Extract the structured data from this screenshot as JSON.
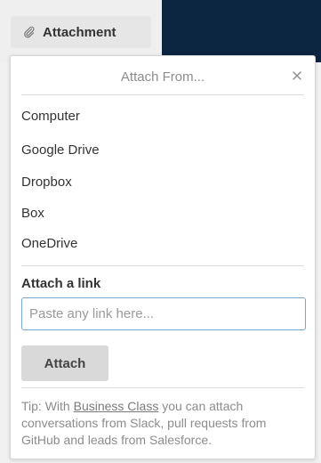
{
  "attachment_button": {
    "label": "Attachment",
    "icon": "paperclip-icon"
  },
  "popover": {
    "title": "Attach From...",
    "close_icon": "close-icon",
    "sources": [
      {
        "label": "Computer"
      },
      {
        "label": "Google Drive"
      },
      {
        "label": "Dropbox"
      },
      {
        "label": "Box"
      },
      {
        "label": "OneDrive"
      }
    ],
    "link_section": {
      "label": "Attach a link",
      "placeholder": "Paste any link here...",
      "value": "",
      "attach_label": "Attach"
    },
    "tip": {
      "prefix": "Tip: With ",
      "link_text": "Business Class",
      "suffix": " you can attach conversations from Slack, pull requests from GitHub and leads from Salesforce."
    }
  },
  "colors": {
    "dark_background": "#0c2540",
    "input_border": "#79a9d3",
    "button_background": "#d9d9d9"
  }
}
